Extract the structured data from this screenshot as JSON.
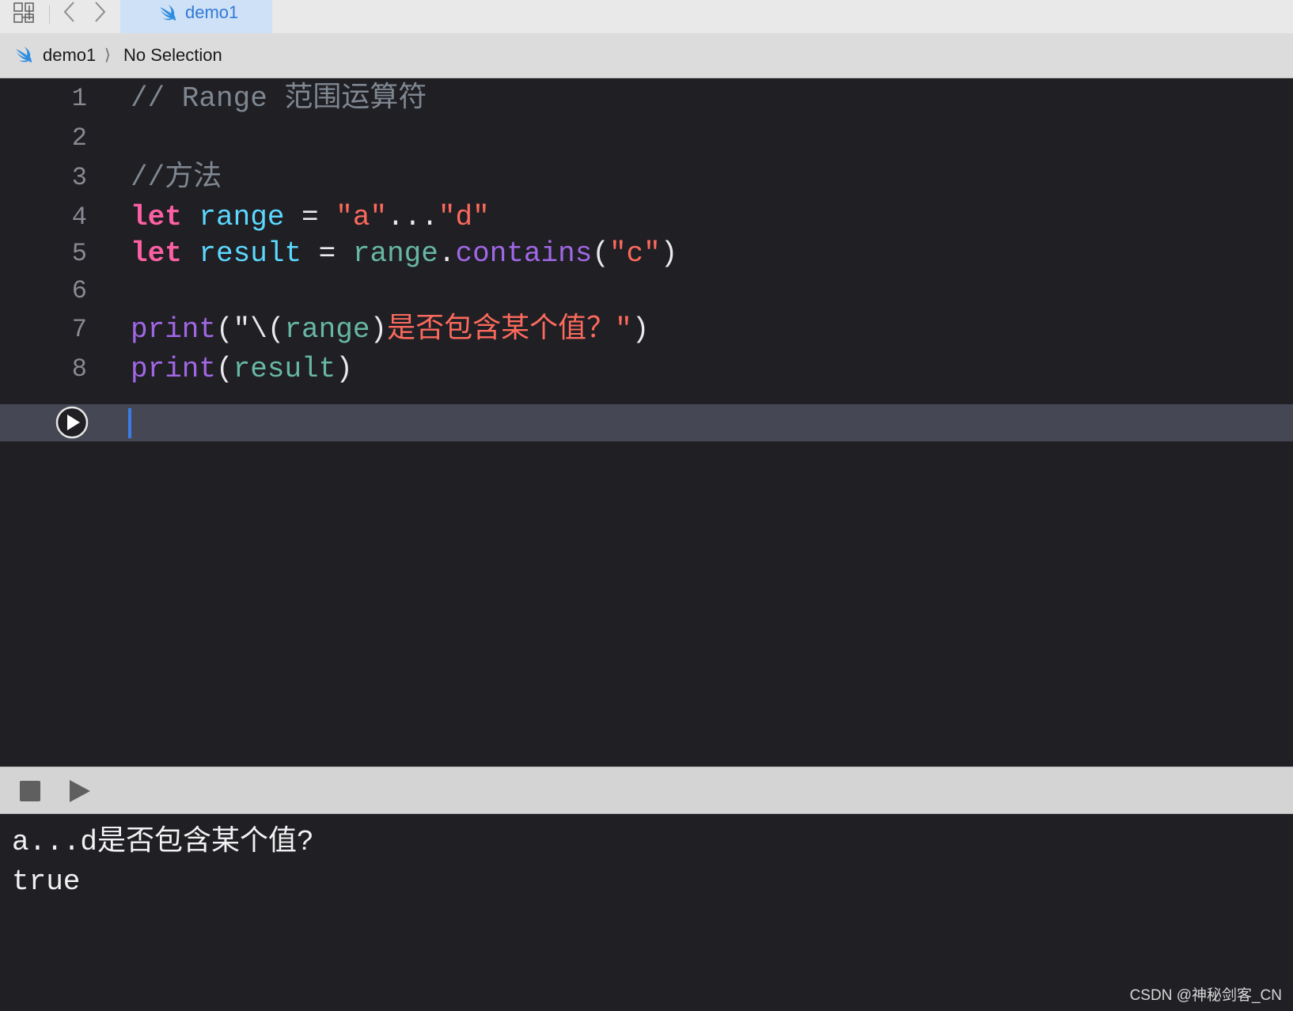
{
  "tabbar": {
    "tab_label": "demo1"
  },
  "jumpbar": {
    "crumb_project": "demo1",
    "chevron": "⟩",
    "crumb_selection": "No Selection"
  },
  "editor": {
    "lines": [
      {
        "num": "1",
        "tokens": [
          {
            "t": "// Range 范围运算符",
            "k": "comment"
          }
        ]
      },
      {
        "num": "2",
        "tokens": []
      },
      {
        "num": "3",
        "tokens": [
          {
            "t": "//方法",
            "k": "comment"
          }
        ]
      },
      {
        "num": "4",
        "tokens": [
          {
            "t": "let",
            "k": "kw"
          },
          {
            "t": " ",
            "k": "plain"
          },
          {
            "t": "range",
            "k": "var"
          },
          {
            "t": " = ",
            "k": "plain"
          },
          {
            "t": "\"a\"",
            "k": "str"
          },
          {
            "t": "...",
            "k": "plain"
          },
          {
            "t": "\"d\"",
            "k": "str"
          }
        ]
      },
      {
        "num": "5",
        "tokens": [
          {
            "t": "let",
            "k": "kw"
          },
          {
            "t": " ",
            "k": "plain"
          },
          {
            "t": "result",
            "k": "var"
          },
          {
            "t": " = ",
            "k": "plain"
          },
          {
            "t": "range",
            "k": "ref"
          },
          {
            "t": ".",
            "k": "plain"
          },
          {
            "t": "contains",
            "k": "fn"
          },
          {
            "t": "(",
            "k": "plain"
          },
          {
            "t": "\"c\"",
            "k": "str"
          },
          {
            "t": ")",
            "k": "plain"
          }
        ]
      },
      {
        "num": "6",
        "tokens": []
      },
      {
        "num": "7",
        "tokens": [
          {
            "t": "print",
            "k": "fn"
          },
          {
            "t": "(",
            "k": "plain"
          },
          {
            "t": "\"\\(",
            "k": "plain"
          },
          {
            "t": "range",
            "k": "ref"
          },
          {
            "t": ")",
            "k": "plain"
          },
          {
            "t": "是否包含某个值？\"",
            "k": "str"
          },
          {
            "t": ")",
            "k": "plain"
          }
        ]
      },
      {
        "num": "8",
        "tokens": [
          {
            "t": "print",
            "k": "fn"
          },
          {
            "t": "(",
            "k": "plain"
          },
          {
            "t": "result",
            "k": "ref"
          },
          {
            "t": ")",
            "k": "plain"
          }
        ]
      }
    ]
  },
  "console": {
    "output": [
      "a...d是否包含某个值?",
      "true"
    ]
  },
  "watermark": "CSDN @神秘剑客_CN",
  "colors": {
    "keyword": "#fc5fa3",
    "variable": "#5dd8ff",
    "reference": "#67b7a4",
    "string": "#fc6a5d",
    "function": "#a167e6",
    "comment": "#7f8791",
    "accent": "#2f7ad9"
  },
  "icons": {
    "grid": "grid-icon",
    "back": "chevron-left-icon",
    "forward": "chevron-right-icon",
    "swift": "swift-icon",
    "run": "run-circle-icon",
    "stop": "stop-icon",
    "play": "play-icon"
  }
}
